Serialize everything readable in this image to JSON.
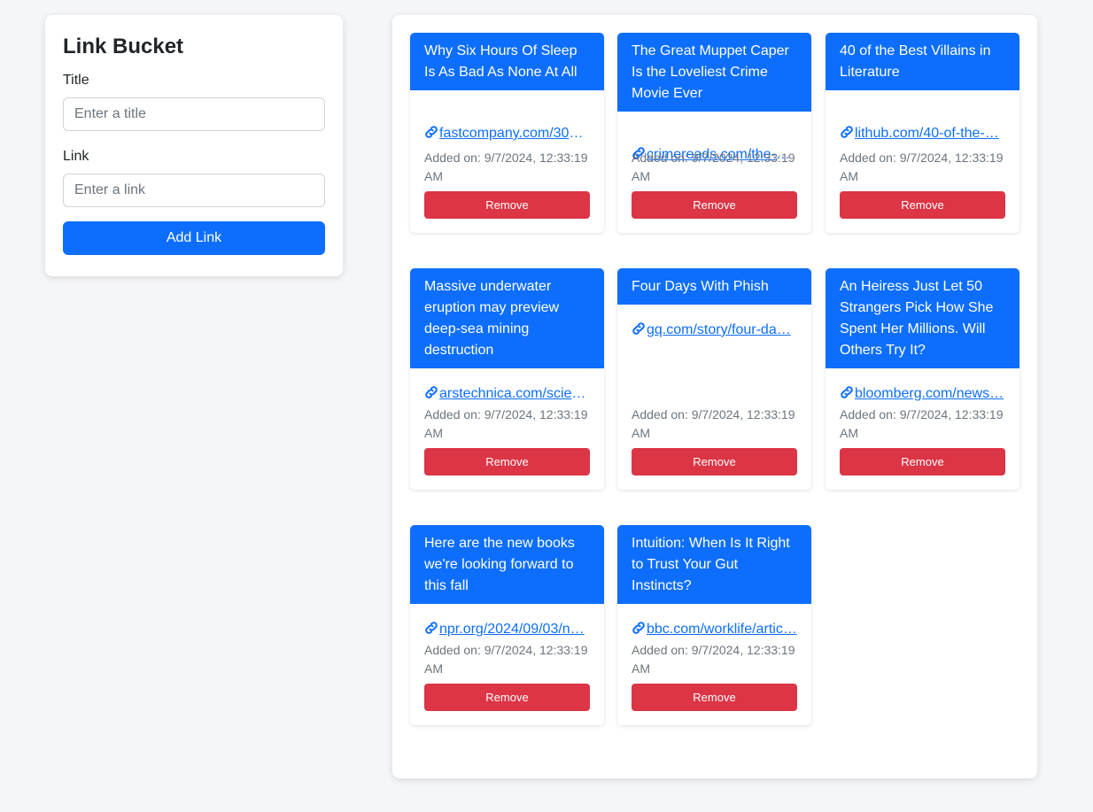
{
  "form": {
    "title": "Link Bucket",
    "title_label": "Title",
    "title_placeholder": "Enter a title",
    "title_value": "",
    "link_label": "Link",
    "link_placeholder": "Enter a link",
    "link_value": "",
    "submit_label": "Add Link"
  },
  "links": [
    {
      "title": "Why Six Hours Of Sleep Is As Bad As None At All",
      "url_text": "fastcompany.com/305…",
      "added": "Added on: 9/7/2024, 12:33:19 AM",
      "remove_label": "Remove"
    },
    {
      "title": "The Great Muppet Caper Is the Loveliest Crime Movie Ever",
      "url_text": "crimereads.com/the-g…",
      "added": "Added on: 9/7/2024, 12:33:19 AM",
      "remove_label": "Remove"
    },
    {
      "title": "40 of the Best Villains in Literature",
      "url_text": "lithub.com/40-of-the-…",
      "added": "Added on: 9/7/2024, 12:33:19 AM",
      "remove_label": "Remove"
    },
    {
      "title": "Massive underwater eruption may preview deep-sea mining destruction",
      "url_text": "arstechnica.com/scien…",
      "added": "Added on: 9/7/2024, 12:33:19 AM",
      "remove_label": "Remove"
    },
    {
      "title": "Four Days With Phish",
      "url_text": "gq.com/story/four-da…",
      "added": "Added on: 9/7/2024, 12:33:19 AM",
      "remove_label": "Remove"
    },
    {
      "title": "An Heiress Just Let 50 Strangers Pick How She Spent Her Millions. Will Others Try It?",
      "url_text": "bloomberg.com/news…",
      "added": "Added on: 9/7/2024, 12:33:19 AM",
      "remove_label": "Remove"
    },
    {
      "title": "Here are the new books we're looking forward to this fall",
      "url_text": "npr.org/2024/09/03/n…",
      "added": "Added on: 9/7/2024, 12:33:19 AM",
      "remove_label": "Remove"
    },
    {
      "title": "Intuition: When Is It Right to Trust Your Gut Instincts?",
      "url_text": "bbc.com/worklife/artic…",
      "added": "Added on: 9/7/2024, 12:33:19 AM",
      "remove_label": "Remove"
    }
  ],
  "icons": {
    "link": "link-icon"
  },
  "colors": {
    "primary": "#0d6efd",
    "danger": "#dc3545"
  }
}
